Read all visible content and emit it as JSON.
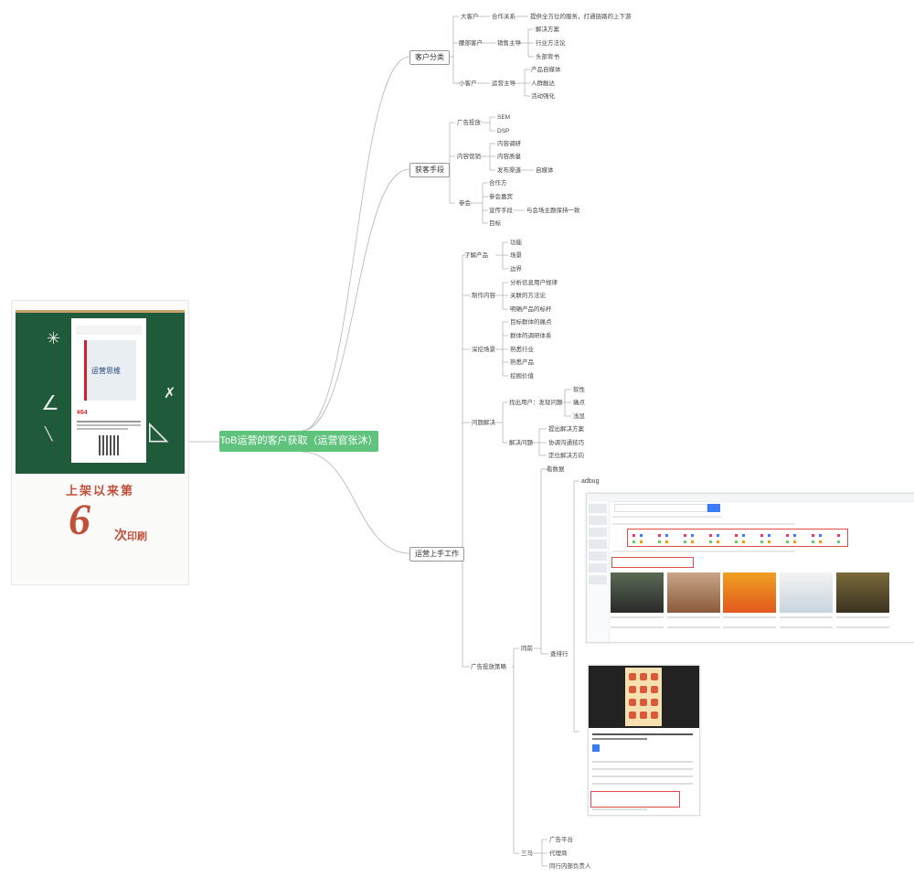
{
  "root": "ToB运营的客户获取（运营官张沐）",
  "colors": {
    "root_bg": "#5fc37d",
    "line": "#b5b5b5",
    "poster_accent": "#c0503a",
    "board": "#1f5a3a"
  },
  "poster": {
    "line1": "上架以来第",
    "big": "6",
    "line2": "次",
    "line2_suffix": "印刷",
    "book_title": "运营思维",
    "book_price": "¥64"
  },
  "branches": {
    "b1": {
      "label": "客户分类",
      "big": "大客户",
      "big_rel": "合作关系",
      "big_desc": "提供全方位的服务，打通链路的上下游",
      "mid": "腰部客户",
      "mid_focus": "销售主导",
      "mid_items": [
        "解决方案",
        "行业方法论",
        "头部背书"
      ],
      "small": "小客户",
      "small_focus": "运营主导",
      "small_items": [
        "产品自媒体",
        "人群触达",
        "活动强化"
      ]
    },
    "b2": {
      "label": "获客手段",
      "ad": "广告投放",
      "ad_items": [
        "SEM",
        "DSP"
      ],
      "content": "内容营销",
      "content_items": [
        "内容调研",
        "内容质量",
        "发布渠道"
      ],
      "content_extra": "自媒体",
      "event": "参会",
      "event_items": [
        "合作方",
        "参会嘉宾",
        "宣传手段",
        "目标"
      ],
      "event_extra": "与会场主题保持一致"
    },
    "b3": {
      "label": "运营上手工作",
      "know": "了解产品",
      "know_items": [
        "功能",
        "场景",
        "边界"
      ],
      "make": "制作内容",
      "make_items": [
        "分析信息用户规律",
        "关联的方法论",
        "明确产品的标杆"
      ],
      "dig": "深挖场景",
      "dig_items": [
        "目标群体的痛点",
        "群体的调研体系",
        "熟悉行业",
        "熟悉产品",
        "挖掘价值"
      ],
      "solve": "问题解决",
      "find": "找出用户：发现问题",
      "find_items": [
        "软性",
        "痛点",
        "浅显"
      ],
      "resolve": "解决问题",
      "resolve_items": [
        "提出解决方案",
        "协调沟通技巧",
        "定位解决方向"
      ],
      "ad_strategy": "广告投放策略",
      "pro": "同前",
      "pro_top": "看数据",
      "pro_tool": "adbug",
      "pro_mid": "查排行",
      "three": "三马",
      "three_items": [
        "广告平台",
        "代理商",
        "同行内部负责人"
      ]
    }
  }
}
